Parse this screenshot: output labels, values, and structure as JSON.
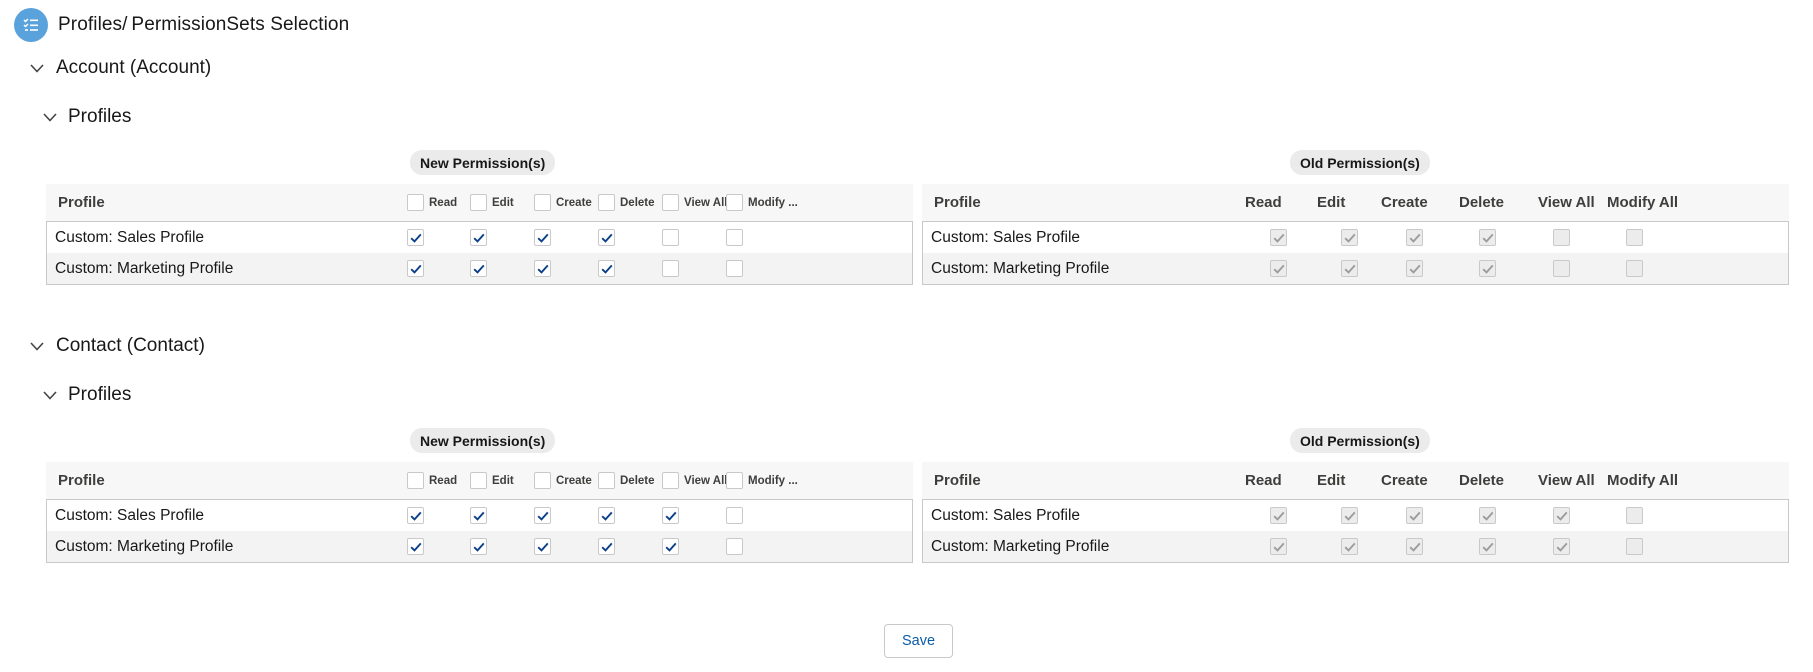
{
  "header": {
    "title": "Profiles/ PermissionSets Selection",
    "icon": "list-settings-icon",
    "icon_bg": "#5aa2dc"
  },
  "new_label": "New Permission(s)",
  "old_label": "Old Permission(s)",
  "profile_col": "Profile",
  "perm_headers_new": [
    "Read",
    "Edit",
    "Create",
    "Delete",
    "View All",
    "Modify ..."
  ],
  "perm_headers_old": [
    "Read",
    "Edit",
    "Create",
    "Delete",
    "View All",
    "Modify All"
  ],
  "sections": [
    {
      "object_label": "Account (Account)",
      "sub_label": "Profiles",
      "rows": [
        {
          "name": "Custom: Sales Profile",
          "new": [
            true,
            true,
            true,
            true,
            false,
            false
          ],
          "old": [
            true,
            true,
            true,
            true,
            false,
            false
          ]
        },
        {
          "name": "Custom: Marketing Profile",
          "new": [
            true,
            true,
            true,
            true,
            false,
            false
          ],
          "old": [
            true,
            true,
            true,
            true,
            false,
            false
          ]
        }
      ]
    },
    {
      "object_label": "Contact (Contact)",
      "sub_label": "Profiles",
      "rows": [
        {
          "name": "Custom: Sales Profile",
          "new": [
            true,
            true,
            true,
            true,
            true,
            false
          ],
          "old": [
            true,
            true,
            true,
            true,
            true,
            false
          ]
        },
        {
          "name": "Custom: Marketing Profile",
          "new": [
            true,
            true,
            true,
            true,
            true,
            false
          ],
          "old": [
            true,
            true,
            true,
            true,
            true,
            false
          ]
        }
      ]
    }
  ],
  "save_label": "Save",
  "colors": {
    "check_active": "#0b3f8a",
    "check_disabled": "#9c9c9c",
    "accent": "#0b5cab"
  }
}
